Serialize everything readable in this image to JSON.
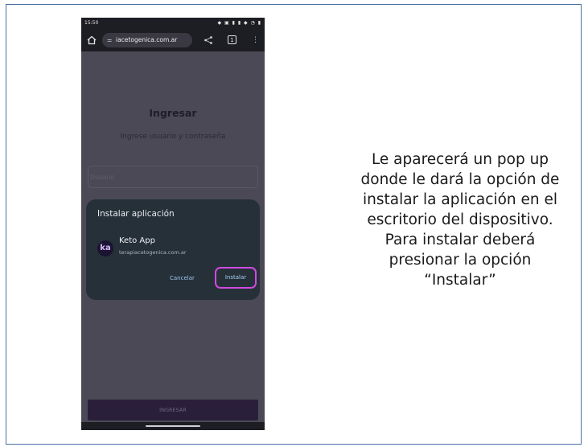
{
  "statusbar": {
    "time": "15:50",
    "icons": "◆ ▣  ▮ ▮ ◆ ◔ ▮"
  },
  "browser": {
    "url": "iacetogenica.com.ar",
    "tab_count": "1"
  },
  "login": {
    "title": "Ingresar",
    "subtitle": "Ingrese usuario y contraseña",
    "username_placeholder": "Usuario",
    "submit_label": "INGRESAR"
  },
  "install_dialog": {
    "title": "Instalar aplicación",
    "app_icon_text": "ka",
    "app_name": "Keto App",
    "app_url": "terapiacetogenica.com.ar",
    "cancel_label": "Cancelar",
    "install_label": "Instalar",
    "highlight_color": "#d14ae0"
  },
  "caption": {
    "lines": [
      "Le aparecerá un pop up",
      "donde le dará la opción de",
      "instalar la aplicación en el",
      "escritorio del dispositivo.",
      "Para instalar deberá",
      "presionar la opción",
      "“Instalar”"
    ]
  }
}
